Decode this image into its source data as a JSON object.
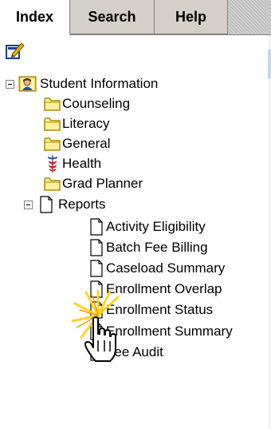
{
  "tabs": [
    {
      "label": "Index",
      "active": true
    },
    {
      "label": "Search",
      "active": false
    },
    {
      "label": "Help",
      "active": false
    }
  ],
  "tree": {
    "root": {
      "label": "Student Information",
      "expanded": true
    },
    "folders": [
      {
        "label": "Counseling",
        "icon": "folder-icon"
      },
      {
        "label": "Literacy",
        "icon": "folder-icon"
      },
      {
        "label": "General",
        "icon": "folder-icon"
      },
      {
        "label": "Health",
        "icon": "caduceus-icon"
      },
      {
        "label": "Grad Planner",
        "icon": "folder-icon"
      }
    ],
    "reports": {
      "label": "Reports",
      "expanded": true,
      "items": [
        {
          "label": "Activity Eligibility"
        },
        {
          "label": "Batch Fee Billing"
        },
        {
          "label": "Caseload Summary"
        },
        {
          "label": "Enrollment Overlap"
        },
        {
          "label": "Enrollment Status"
        },
        {
          "label": "Enrollment Summary"
        },
        {
          "label": "Fee Audit"
        }
      ]
    }
  },
  "colors": {
    "folder_fill": "#ffef9e",
    "folder_stroke": "#b08a00",
    "tab_inactive": "#d4d0c8"
  }
}
